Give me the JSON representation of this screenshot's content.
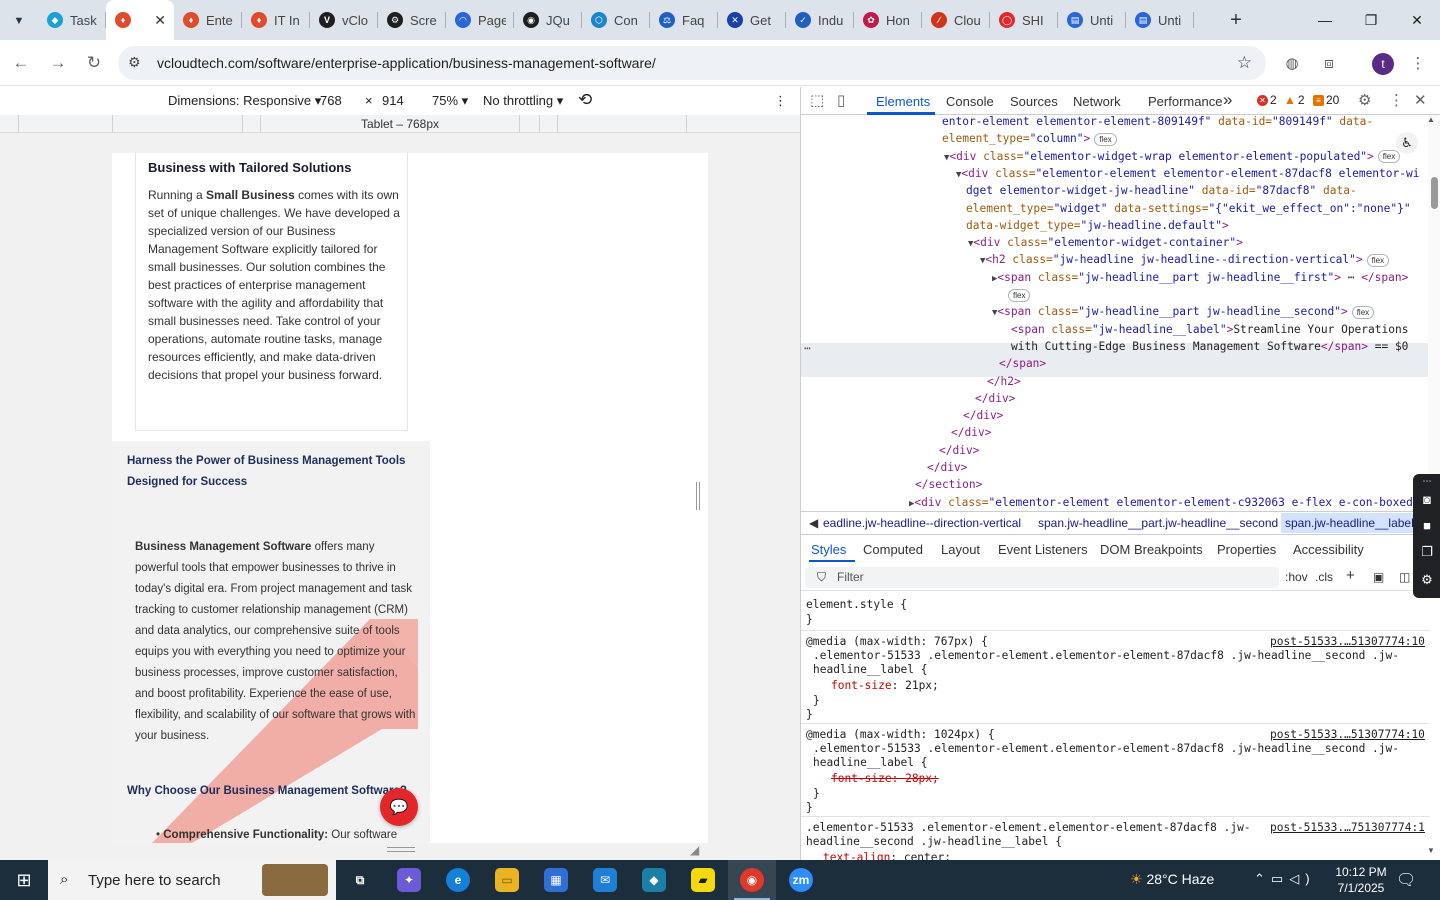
{
  "browser": {
    "tabs": [
      {
        "label": "Task",
        "color": "#1aa1d6",
        "glyph": "◆"
      },
      {
        "label": "",
        "color": "#e24a2c",
        "glyph": "♦",
        "active": true
      },
      {
        "label": "Ente",
        "color": "#e24a2c",
        "glyph": "♦"
      },
      {
        "label": "IT In",
        "color": "#e24a2c",
        "glyph": "♦"
      },
      {
        "label": "vClo",
        "color": "#1f1f1f",
        "glyph": "V"
      },
      {
        "label": "Scre",
        "color": "#1f1f1f",
        "glyph": "⚙"
      },
      {
        "label": "Page",
        "color": "#2a66d6",
        "glyph": "◠"
      },
      {
        "label": "JQu",
        "color": "#1f1f1f",
        "glyph": "◉"
      },
      {
        "label": "Con",
        "color": "#1a86c9",
        "glyph": "⬡"
      },
      {
        "label": "Faq",
        "color": "#1f5fbf",
        "glyph": "⚖"
      },
      {
        "label": "Get",
        "color": "#1b3fa8",
        "glyph": "✕"
      },
      {
        "label": "Indu",
        "color": "#1f5fbf",
        "glyph": "✓"
      },
      {
        "label": "Hon",
        "color": "#c0194a",
        "glyph": "✿"
      },
      {
        "label": "Clou",
        "color": "#d2331d",
        "glyph": "∕"
      },
      {
        "label": "SHI",
        "color": "#e4272d",
        "glyph": "◯"
      },
      {
        "label": "Unti",
        "color": "#2a66d6",
        "glyph": "▤"
      },
      {
        "label": "Unti",
        "color": "#2a66d6",
        "glyph": "▤"
      }
    ],
    "new_tab": "+",
    "url": "vcloudtech.com/software/enterprise-application/business-management-software/",
    "avatar_letter": "t"
  },
  "device_toolbar": {
    "dimensions_label": "Dimensions: Responsive",
    "width": "768",
    "times": "×",
    "height": "914",
    "zoom": "75%",
    "throttling": "No throttling",
    "ruler_label": "Tablet – 768px"
  },
  "page": {
    "card_title": "Business with Tailored Solutions",
    "card_body_prefix": "Running a ",
    "card_body_bold": "Small Business",
    "card_body_rest": " comes with its own set of unique challenges. We have developed a specialized version of our Business Management Software explicitly tailored for small businesses. Our solution combines the best practices of enterprise management software with the agility and affordability that small businesses need. Take control of your operations, automate routine tasks, manage resources efficiently, and make data-driven decisions that propel your business forward.",
    "section_heading": "Harness the Power of Business Management Tools Designed for Success",
    "section_body_bold": "Business Management Software",
    "section_body_rest": " offers many powerful tools that empower businesses to thrive in today's digital era. From project management and task tracking to customer relationship management (CRM) and data analytics, our comprehensive suite of tools equips you with everything you need to optimize your business processes, improve customer satisfaction, and boost profitability. Experience the ease of use, flexibility, and scalability of our software that grows with your business.",
    "why_heading": "Why Choose Our Business Management Software?",
    "bullet_bold": "Comprehensive Functionality:",
    "bullet_rest": " Our software"
  },
  "devtools": {
    "tabs": [
      "Elements",
      "Console",
      "Sources",
      "Network",
      "Performance"
    ],
    "more": "»",
    "errors": "2",
    "warnings": "2",
    "issues": "20",
    "dom_lines": [
      {
        "indent": 149,
        "parts": [
          [
            "av",
            "entor-element elementor-element-809149f\""
          ],
          [
            "an",
            " data-id="
          ],
          [
            "av",
            "\"809149f\""
          ],
          [
            "an",
            " data-"
          ]
        ]
      },
      {
        "indent": 149,
        "parts": [
          [
            "an",
            "element_type="
          ],
          [
            "av",
            "\"column\""
          ],
          [
            "tag",
            ">"
          ]
        ],
        "flex": true
      },
      {
        "indent": 151,
        "tri": "▼",
        "parts": [
          [
            "tag",
            "<div "
          ],
          [
            "an",
            "class="
          ],
          [
            "av",
            "\"elementor-widget-wrap elementor-element-populated\""
          ],
          [
            "tag",
            ">"
          ]
        ],
        "flex": true
      },
      {
        "indent": 163,
        "tri": "▼",
        "parts": [
          [
            "tag",
            "<div "
          ],
          [
            "an",
            "class="
          ],
          [
            "av",
            "\"elementor-element elementor-element-87dacf8 elementor-wi"
          ]
        ]
      },
      {
        "indent": 173,
        "parts": [
          [
            "av",
            "dget elementor-widget-jw-headline\""
          ],
          [
            "an",
            " data-id="
          ],
          [
            "av",
            "\"87dacf8\""
          ],
          [
            "an",
            " data-"
          ]
        ]
      },
      {
        "indent": 173,
        "parts": [
          [
            "an",
            "element_type="
          ],
          [
            "av",
            "\"widget\""
          ],
          [
            "an",
            " data-settings="
          ],
          [
            "av",
            "\"{\"ekit_we_effect_on\":\"none\"}\""
          ]
        ]
      },
      {
        "indent": 173,
        "parts": [
          [
            "an",
            "data-widget_type="
          ],
          [
            "av",
            "\"jw-headline.default\""
          ],
          [
            "tag",
            ">"
          ]
        ]
      },
      {
        "indent": 175,
        "tri": "▼",
        "parts": [
          [
            "tag",
            "<div "
          ],
          [
            "an",
            "class="
          ],
          [
            "av",
            "\"elementor-widget-container\""
          ],
          [
            "tag",
            ">"
          ]
        ]
      },
      {
        "indent": 187,
        "tri": "▼",
        "parts": [
          [
            "tag",
            "<h2 "
          ],
          [
            "an",
            "class="
          ],
          [
            "av",
            "\"jw-headline jw-headline--direction-vertical\""
          ],
          [
            "tag",
            ">"
          ]
        ],
        "flex": true
      },
      {
        "indent": 199,
        "tri": "▶",
        "parts": [
          [
            "tag",
            "<span "
          ],
          [
            "an",
            "class="
          ],
          [
            "av",
            "\"jw-headline__part jw-headline__first\""
          ],
          [
            "tag",
            ">"
          ],
          [
            "tx",
            " ⋯ "
          ],
          [
            "tag",
            "</span>"
          ]
        ]
      },
      {
        "indent": 211,
        "parts": [],
        "flex": true
      },
      {
        "indent": 199,
        "tri": "▼",
        "parts": [
          [
            "tag",
            "<span "
          ],
          [
            "an",
            "class="
          ],
          [
            "av",
            "\"jw-headline__part jw-headline__second\""
          ],
          [
            "tag",
            ">"
          ]
        ],
        "flex": true
      },
      {
        "indent": 218,
        "parts": [
          [
            "tag",
            "<span "
          ],
          [
            "an",
            "class="
          ],
          [
            "av",
            "\"jw-headline__label\""
          ],
          [
            "tag",
            ">"
          ],
          [
            "tx",
            "Streamline Your Operations"
          ]
        ]
      },
      {
        "indent": 218,
        "parts": [
          [
            "tx",
            "with Cutting-Edge Business Management Software"
          ],
          [
            "tag",
            "</span>"
          ],
          [
            "tx",
            " == $0"
          ]
        ]
      },
      {
        "indent": 206,
        "parts": [
          [
            "tag",
            "</span>"
          ]
        ]
      },
      {
        "indent": 194,
        "parts": [
          [
            "tag",
            "</h2>"
          ]
        ]
      },
      {
        "indent": 182,
        "parts": [
          [
            "tag",
            "</div>"
          ]
        ]
      },
      {
        "indent": 170,
        "parts": [
          [
            "tag",
            "</div>"
          ]
        ]
      },
      {
        "indent": 158,
        "parts": [
          [
            "tag",
            "</div>"
          ]
        ]
      },
      {
        "indent": 146,
        "parts": [
          [
            "tag",
            "</div>"
          ]
        ]
      },
      {
        "indent": 134,
        "parts": [
          [
            "tag",
            "</div>"
          ]
        ]
      },
      {
        "indent": 122,
        "parts": [
          [
            "tag",
            "</section>"
          ]
        ]
      },
      {
        "indent": 116,
        "tri": "▶",
        "parts": [
          [
            "tag",
            "<div "
          ],
          [
            "an",
            "class="
          ],
          [
            "av",
            "\"elementor-element elementor-element-c932063 e-flex e-con-boxed"
          ]
        ]
      }
    ],
    "breadcrumbs": [
      "eadline.jw-headline--direction-vertical",
      "span.jw-headline__part.jw-headline__second",
      "span.jw-headline__label"
    ],
    "style_tabs": [
      "Styles",
      "Computed",
      "Layout",
      "Event Listeners",
      "DOM Breakpoints",
      "Properties",
      "Accessibility"
    ],
    "filter_placeholder": "Filter",
    "hov": ":hov",
    "cls": ".cls",
    "rules": {
      "element_style": "element.style {",
      "close": "}",
      "r1_media": "@media (max-width: 767px) {",
      "r1_src": "post-51533.…51307774:10",
      "r1_sel1": ".elementor-51533 .elementor-element.elementor-element-87dacf8 .jw-headline__second .jw-",
      "r1_sel2": "headline__label {",
      "r1_prop": "font-size",
      "r1_val": ": 21px;",
      "r2_media": "@media (max-width: 1024px) {",
      "r2_src": "post-51533.…51307774:10",
      "r2_sel1": ".elementor-51533 .elementor-element.elementor-element-87dacf8 .jw-headline__second .jw-",
      "r2_sel2": "headline__label {",
      "r2_prop": "font-size: 28px;",
      "r3_sel1": ".elementor-51533 .elementor-element.elementor-element-87dacf8 .jw-",
      "r3_src": "post-51533.…751307774:1",
      "r3_sel2": "headline__second .jw-headline__label {",
      "r3_prop": "text-align",
      "r3_val": ": center;"
    }
  },
  "taskbar": {
    "search_placeholder": "Type here to search",
    "weather": "28°C  Haze",
    "time": "10:12 PM",
    "date": "7/1/2025",
    "apps": [
      {
        "name": "task-view",
        "glyph": "⧉",
        "bg": "transparent",
        "fg": "#ffffff"
      },
      {
        "name": "copilot",
        "glyph": "✦",
        "bg": "#6b5bd6",
        "fg": "#ffffff"
      },
      {
        "name": "edge",
        "glyph": "e",
        "bg": "#1580d8",
        "fg": "#ffffff"
      },
      {
        "name": "file-explorer",
        "glyph": "▭",
        "bg": "#e8b422",
        "fg": "#7a5b00"
      },
      {
        "name": "store",
        "glyph": "▦",
        "bg": "#2f6fd6",
        "fg": "#ffffff"
      },
      {
        "name": "mail",
        "glyph": "✉",
        "bg": "#1f7fd4",
        "fg": "#ffffff"
      },
      {
        "name": "app-blue",
        "glyph": "◆",
        "bg": "#1b7fa8",
        "fg": "#ffffff"
      },
      {
        "name": "sticky-notes",
        "glyph": "▰",
        "bg": "#f5d90f",
        "fg": "#1a1a1a"
      },
      {
        "name": "chrome",
        "glyph": "◉",
        "bg": "#e0392b",
        "fg": "#ffffff",
        "active": true
      },
      {
        "name": "zoom",
        "glyph": "zm",
        "bg": "#2d8cff",
        "fg": "#ffffff"
      }
    ]
  }
}
